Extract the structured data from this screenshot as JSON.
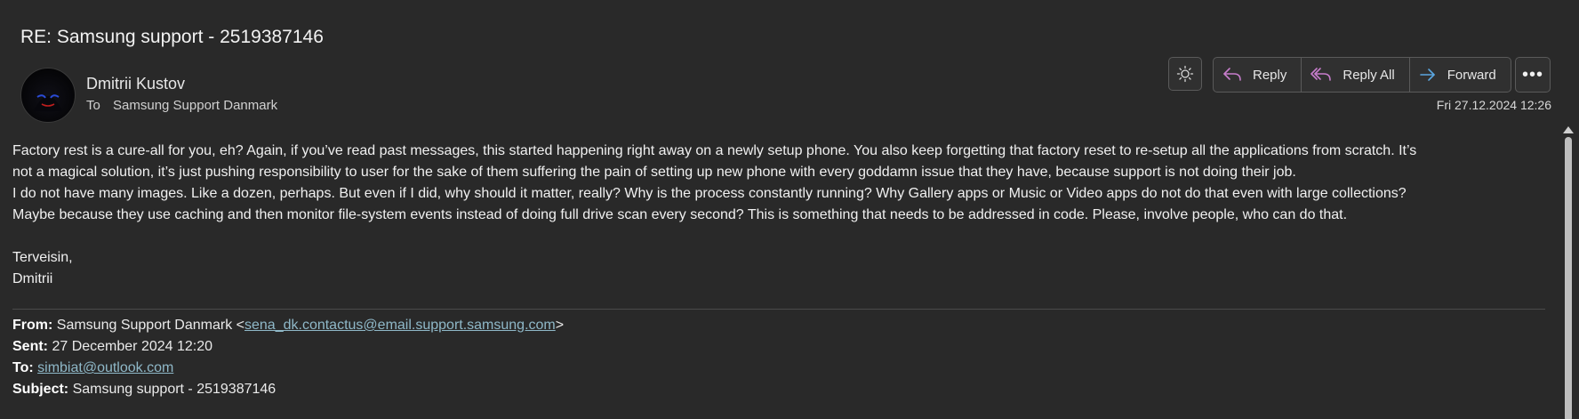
{
  "message": {
    "subject": "RE: Samsung support - 2519387146",
    "sender_name": "Dmitrii Kustov",
    "to_label": "To",
    "recipient": "Samsung Support Danmark",
    "date": "Fri 27.12.2024 12:26"
  },
  "toolbar": {
    "reply_label": "Reply",
    "reply_all_label": "Reply All",
    "forward_label": "Forward",
    "more_label": "•••",
    "icons": {
      "theme": "sun-icon",
      "reply": "reply-arrow-icon",
      "reply_all": "reply-all-arrow-icon",
      "forward": "forward-arrow-icon"
    },
    "colors": {
      "reply_icon": "#c77dcc",
      "forward_icon": "#5aa6e0"
    }
  },
  "body": {
    "paragraph1_line1": "Factory rest is a cure-all for you, eh? Again, if you’ve read past messages, this started happening right away on a newly setup phone. You also keep forgetting that factory reset to re-setup all the applications from scratch. It’s",
    "paragraph1_line2": "not a magical solution, it’s just pushing responsibility to user for the sake of them suffering the pain of setting up new phone with every goddamn issue that they have, because support is not doing their job.",
    "paragraph2_line1": "I do not have many images. Like a dozen, perhaps. But even if I did, why should it matter, really? Why is the process constantly running? Why Gallery apps or Music or Video apps do not do that even with large collections?",
    "paragraph2_line2": "Maybe because they use caching and then monitor file-system events instead of doing full drive scan every second? This is something that needs to be addressed in code. Please, involve people, who can do that.",
    "signoff_greeting": "Terveisin,",
    "signoff_name": "Dmitrii"
  },
  "quoted": {
    "from_label": "From:",
    "from_name": "Samsung Support Danmark <",
    "from_email": "sena_dk.contactus@email.support.samsung.com",
    "from_close": ">",
    "sent_label": "Sent:",
    "sent_value": "27 December 2024 12:20",
    "to_label": "To:",
    "to_email": "simbiat@outlook.com",
    "subject_label": "Subject:",
    "subject_value": "Samsung support - 2519387146"
  }
}
